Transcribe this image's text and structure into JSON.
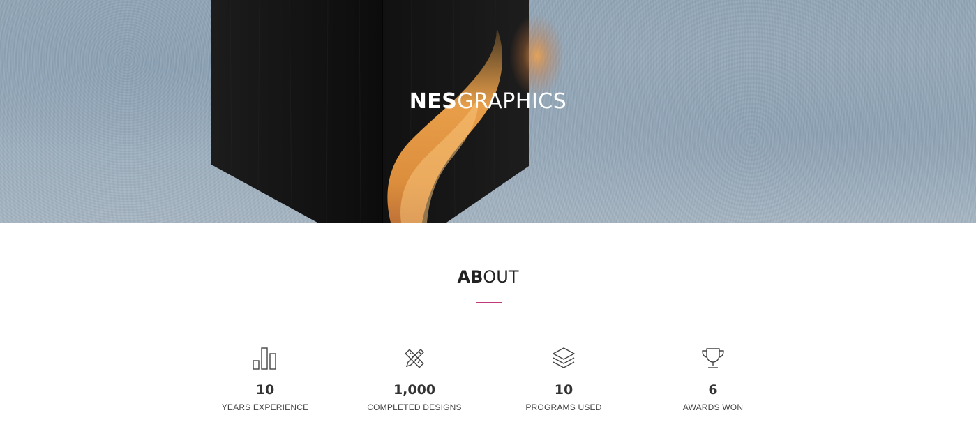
{
  "hero": {
    "title_bold": "NES",
    "title_light": "GRAPHICS"
  },
  "about": {
    "heading_bold": "AB",
    "heading_light": "OUT",
    "accent_color": "#c0397a",
    "stats": [
      {
        "icon": "bar-chart-icon",
        "value": "10",
        "label": "YEARS EXPERIENCE"
      },
      {
        "icon": "pencil-ruler-icon",
        "value": "1,000",
        "label": "COMPLETED DESIGNS"
      },
      {
        "icon": "layers-icon",
        "value": "10",
        "label": "PROGRAMS USED"
      },
      {
        "icon": "trophy-icon",
        "value": "6",
        "label": "AWARDS WON"
      }
    ]
  }
}
